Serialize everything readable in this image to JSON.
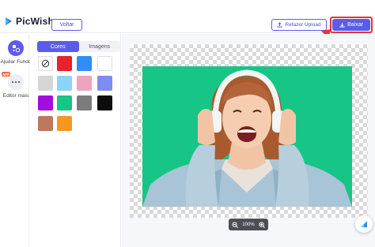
{
  "header": {
    "app_name": "PicWish",
    "back_label": "Voltar",
    "redo_upload_label": "Refazer Upload",
    "download_label": "Baixar"
  },
  "sidebar": {
    "items": [
      {
        "label": "Ajudar Fundo",
        "icon": "background-tool-icon"
      },
      {
        "label": "Editor mais",
        "icon": "more-dots-icon",
        "badge": "APP"
      }
    ]
  },
  "panel": {
    "tabs": [
      {
        "label": "Cores",
        "active": true
      },
      {
        "label": "Imagens",
        "active": false
      }
    ],
    "swatches": [
      "none",
      "#e8232c",
      "#2f8ff5",
      "#ffffff",
      "#d6d6d6",
      "#8dd3f5",
      "#eea4bf",
      "#7d8cf2",
      "#a10ee0",
      "#17c587",
      "#7c7c7c",
      "#0d0d0d",
      "#bb7a5d",
      "#f39a1e"
    ]
  },
  "canvas": {
    "background_color": "#17c587",
    "zoom_level": "100%"
  },
  "colors": {
    "accent": "#5b5ce8",
    "highlight": "#e8313a"
  }
}
